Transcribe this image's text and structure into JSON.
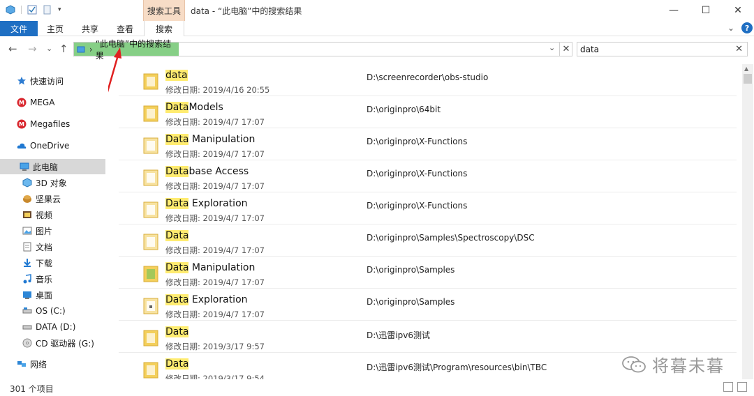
{
  "titlebar": {
    "context_tab": "搜索工具",
    "title": "data - “此电脑”中的搜索结果",
    "minimize": "—",
    "maximize": "☐",
    "close": "✕"
  },
  "ribbon": {
    "tabs": [
      "文件",
      "主页",
      "共享",
      "查看",
      "搜索"
    ],
    "expand_glyph": "⌄",
    "help_glyph": "?"
  },
  "nav": {
    "back": "←",
    "forward": "→",
    "recent": "⌄",
    "up": "↑"
  },
  "address": {
    "separator": "›",
    "text": "“此电脑”中的搜索结果",
    "dropdown": "⌄",
    "clear": "✕"
  },
  "search": {
    "value": "data",
    "clear": "✕"
  },
  "sidebar": {
    "items": [
      {
        "label": "快速访问",
        "icon": "star-icon"
      },
      {
        "label": "MEGA",
        "icon": "mega-icon"
      },
      {
        "label": "Megafiles",
        "icon": "mega-icon"
      },
      {
        "label": "OneDrive",
        "icon": "cloud-icon"
      },
      {
        "label": "此电脑",
        "icon": "computer-icon"
      },
      {
        "label": "3D 对象",
        "icon": "cube-icon"
      },
      {
        "label": "坚果云",
        "icon": "nut-icon"
      },
      {
        "label": "视频",
        "icon": "video-icon"
      },
      {
        "label": "图片",
        "icon": "picture-icon"
      },
      {
        "label": "文档",
        "icon": "document-icon"
      },
      {
        "label": "下载",
        "icon": "download-icon"
      },
      {
        "label": "音乐",
        "icon": "music-icon"
      },
      {
        "label": "桌面",
        "icon": "desktop-icon"
      },
      {
        "label": "OS (C:)",
        "icon": "drive-icon"
      },
      {
        "label": "DATA (D:)",
        "icon": "drive-icon"
      },
      {
        "label": "CD 驱动器 (G:)",
        "icon": "cd-icon"
      },
      {
        "label": "网络",
        "icon": "network-icon"
      }
    ]
  },
  "files": [
    {
      "hl": "data",
      "rest": "",
      "date_label": "修改日期:",
      "date": "2019/4/16 20:55",
      "path": "D:\\screenrecorder\\obs-studio"
    },
    {
      "hl": "Data",
      "rest": "Models",
      "date_label": "修改日期:",
      "date": "2019/4/7 17:07",
      "path": "D:\\originpro\\64bit"
    },
    {
      "hl": "Data",
      "rest": " Manipulation",
      "date_label": "修改日期:",
      "date": "2019/4/7 17:07",
      "path": "D:\\originpro\\X-Functions"
    },
    {
      "hl": "Data",
      "rest": "base Access",
      "date_label": "修改日期:",
      "date": "2019/4/7 17:07",
      "path": "D:\\originpro\\X-Functions"
    },
    {
      "hl": "Data",
      "rest": " Exploration",
      "date_label": "修改日期:",
      "date": "2019/4/7 17:07",
      "path": "D:\\originpro\\X-Functions"
    },
    {
      "hl": "Data",
      "rest": "",
      "date_label": "修改日期:",
      "date": "2019/4/7 17:07",
      "path": "D:\\originpro\\Samples\\Spectroscopy\\DSC"
    },
    {
      "hl": "Data",
      "rest": " Manipulation",
      "date_label": "修改日期:",
      "date": "2019/4/7 17:07",
      "path": "D:\\originpro\\Samples"
    },
    {
      "hl": "Data",
      "rest": " Exploration",
      "date_label": "修改日期:",
      "date": "2019/4/7 17:07",
      "path": "D:\\originpro\\Samples"
    },
    {
      "hl": "Data",
      "rest": "",
      "date_label": "修改日期:",
      "date": "2019/3/17 9:57",
      "path": "D:\\迅雷ipv6测试"
    },
    {
      "hl": "Data",
      "rest": "",
      "date_label": "修改日期:",
      "date": "2019/3/17 9:54",
      "path": "D:\\迅雷ipv6测试\\Program\\resources\\bin\\TBC"
    }
  ],
  "status": {
    "count": "301 个项目"
  },
  "watermark": {
    "text": "将暮未暮"
  },
  "colors": {
    "file_tab": "#1f6fc3",
    "context_tab": "#f7dcc6",
    "address_highlight": "#86cf86",
    "match_highlight": "#ffec70",
    "annotation_arrow": "#e02020",
    "folder": "#f3cf5b"
  }
}
